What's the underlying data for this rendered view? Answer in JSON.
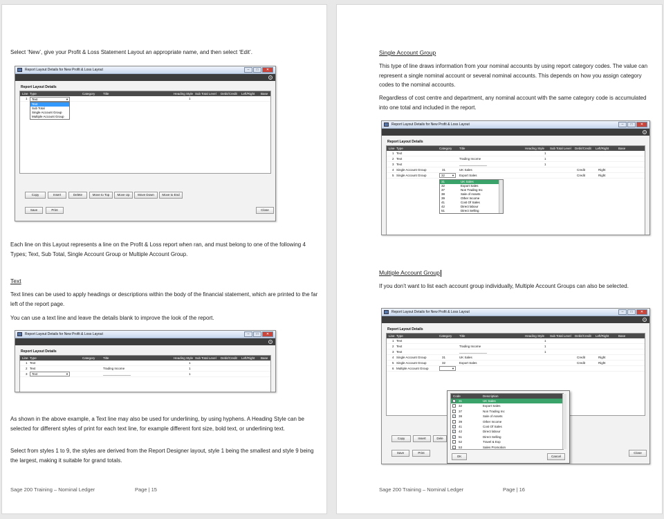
{
  "page1": {
    "intro": "Select ‘New’, give your Profit & Loss Statement Layout an appropriate name, and then select ‘Edit’.",
    "para1": "Each line on this Layout represents a line on the Profit & Loss report when ran, and must belong to one of the following 4 Types; Text, Sub Total, Single Account Group or Multiple Account Group.",
    "text_heading": "Text",
    "text_p1": "Text lines can be used to apply headings or descriptions within the body of the financial statement, which are printed to the far left of the report page.",
    "text_p2": "You can use a text line and leave the details blank to improve the look of the report.",
    "para2": "As shown in the above example, a Text line may also be used for underlining, by using hyphens. A Heading Style can be selected for different styles of print for each text line, for example different font size, bold text, or underlining text.",
    "para3": "Select from styles 1 to 9, the styles are derived from the Report Designer layout, style 1 being the smallest and style 9 being the largest, making it suitable for grand totals.",
    "footer_title": "Sage 200 Training – Nominal Ledger",
    "footer_page": "Page | 15"
  },
  "page2": {
    "single_heading": "Single Account Group",
    "single_p1": "This type of line draws information from your nominal accounts by using report category codes. The value can represent a single nominal account or several nominal accounts. This depends on how you assign category codes to the nominal accounts.",
    "single_p2": "Regardless of cost centre and department, any nominal account with the same category code is accumulated into one total and included in the report.",
    "multi_heading": "Multiple Account Group",
    "multi_p1": "If you don’t want to list each account group individually, Multiple Account Groups can also be selected.",
    "footer_title": "Sage 200 Training – Nominal Ledger",
    "footer_page": "Page | 16"
  },
  "dialog": {
    "window_title": "Report Layout Details for New Profit & Loss Layout",
    "help": "?",
    "section": "Report Layout Details",
    "cols": {
      "line": "Line",
      "type": "Type",
      "category": "Category",
      "title": "Title",
      "heading_style": "Heading Style",
      "sub_total": "Sub Total Level",
      "debit_credit": "Debit/Credit",
      "left_right": "Left/Right",
      "base": "Base"
    },
    "win_min": "–",
    "win_max": "□",
    "win_close": "✕",
    "buttons": {
      "copy": "Copy",
      "insert": "Insert",
      "delete": "Delete",
      "move_top": "Move to Top",
      "move_up": "Move Up",
      "move_down": "Move Down",
      "move_end": "Move to End",
      "save": "Save",
      "print": "Print",
      "close": "Close",
      "ok": "OK",
      "cancel": "Cancel"
    }
  },
  "shot1": {
    "row_line": "1",
    "row_type": "Text",
    "row_style": "1",
    "options": [
      "Text",
      "Sub Total",
      "Single Account Group",
      "Multiple Account Group"
    ]
  },
  "shot2": {
    "rows": [
      {
        "line": "1",
        "type": "Text",
        "category": "",
        "title": "",
        "style": "1"
      },
      {
        "line": "2",
        "type": "Text",
        "category": "",
        "title": "Trading Income",
        "style": "1"
      },
      {
        "line": "3",
        "type": "Text",
        "category": "",
        "title": "________________",
        "style": "1"
      }
    ]
  },
  "shot3": {
    "rows": [
      {
        "line": "1",
        "type": "Text",
        "category": "",
        "title": "",
        "style": "1",
        "dc": "",
        "lr": ""
      },
      {
        "line": "2",
        "type": "Text",
        "category": "",
        "title": "Trading Income",
        "style": "1",
        "dc": "",
        "lr": ""
      },
      {
        "line": "3",
        "type": "Text",
        "category": "",
        "title": "________________",
        "style": "1",
        "dc": "",
        "lr": ""
      },
      {
        "line": "4",
        "type": "Single Account Group",
        "category": "31",
        "title": "UK Sales",
        "style": "",
        "dc": "Credit",
        "lr": "Right"
      },
      {
        "line": "5",
        "type": "Single Account Group",
        "category": "32",
        "title": "Export Sales",
        "style": "",
        "dc": "Credit",
        "lr": "Right"
      }
    ],
    "dropdown": [
      {
        "code": "31",
        "name": "UK Sales"
      },
      {
        "code": "32",
        "name": "Export Sales"
      },
      {
        "code": "37",
        "name": "Non Trading Inc"
      },
      {
        "code": "38",
        "name": "Sale of Assets"
      },
      {
        "code": "39",
        "name": "Other Income"
      },
      {
        "code": "41",
        "name": "Cost Of Sales"
      },
      {
        "code": "42",
        "name": "Direct labour"
      },
      {
        "code": "51",
        "name": "Direct Selling"
      }
    ]
  },
  "shot4": {
    "rows": [
      {
        "line": "1",
        "type": "Text",
        "category": "",
        "title": "",
        "style": "1",
        "dc": "",
        "lr": ""
      },
      {
        "line": "2",
        "type": "Text",
        "category": "",
        "title": "Trading Income",
        "style": "1",
        "dc": "",
        "lr": ""
      },
      {
        "line": "3",
        "type": "Text",
        "category": "",
        "title": "________________",
        "style": "1",
        "dc": "",
        "lr": ""
      },
      {
        "line": "4",
        "type": "Single Account Group",
        "category": "31",
        "title": "UK Sales",
        "style": "",
        "dc": "Credit",
        "lr": "Right"
      },
      {
        "line": "5",
        "type": "Single Account Group",
        "category": "32",
        "title": "Export Sales",
        "style": "",
        "dc": "Credit",
        "lr": "Right"
      },
      {
        "line": "6",
        "type": "Multiple Account Group",
        "category": "",
        "title": "",
        "style": "",
        "dc": "",
        "lr": ""
      }
    ],
    "picker_code": "Code",
    "picker_desc": "Description",
    "picker": [
      {
        "code": "31",
        "name": "UK Sales",
        "checked": true
      },
      {
        "code": "32",
        "name": "Export Sales",
        "checked": false
      },
      {
        "code": "37",
        "name": "Non Trading Inc",
        "checked": false
      },
      {
        "code": "38",
        "name": "Sale of Assets",
        "checked": true
      },
      {
        "code": "39",
        "name": "Other Income",
        "checked": false
      },
      {
        "code": "41",
        "name": "Cost Of Sales",
        "checked": true
      },
      {
        "code": "42",
        "name": "Direct labour",
        "checked": true
      },
      {
        "code": "51",
        "name": "Direct Selling",
        "checked": true
      },
      {
        "code": "52",
        "name": "Travel & Exp",
        "checked": false
      },
      {
        "code": "53",
        "name": "Sales Promotion",
        "checked": false
      }
    ],
    "partial_delete": "Dele"
  }
}
